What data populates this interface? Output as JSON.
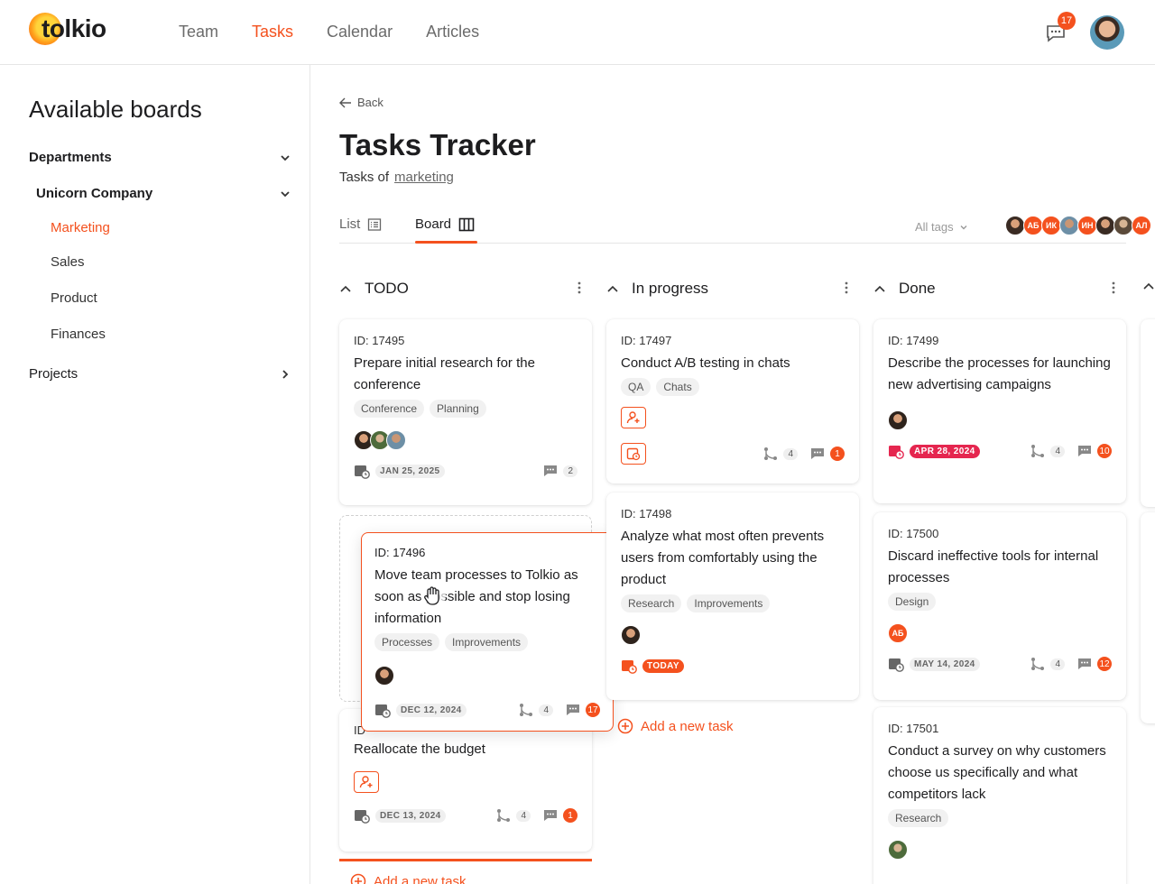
{
  "app": {
    "brand": "tolkio",
    "accent": "#f4511e"
  },
  "nav": {
    "items": [
      "Team",
      "Tasks",
      "Calendar",
      "Articles"
    ],
    "active": "Tasks"
  },
  "header": {
    "notifications_count": "17"
  },
  "sidebar": {
    "title": "Available boards",
    "departments": "Departments",
    "company": "Unicorn Company",
    "items": [
      "Marketing",
      "Sales",
      "Product",
      "Finances"
    ],
    "projects": "Projects"
  },
  "page": {
    "back": "Back",
    "title": "Tasks Tracker",
    "subtitle_prefix": "Tasks of",
    "subtitle_link": "marketing",
    "tabs": [
      "List",
      "Board"
    ],
    "tags_filter": "All tags",
    "team_initials": [
      "АБ",
      "ИК",
      "ИН",
      "АЛ"
    ]
  },
  "columns": [
    {
      "title": "TODO",
      "add_label": "Add a new task"
    },
    {
      "title": "In progress",
      "add_label": "Add a new task"
    },
    {
      "title": "Done"
    }
  ],
  "cards": {
    "c17495": {
      "id": "ID: 17495",
      "title": "Prepare initial research for the conference",
      "tags": [
        "Conference",
        "Planning"
      ],
      "date": "JAN 25, 2025",
      "comments": "2"
    },
    "c17496": {
      "id": "ID: 17496",
      "title": "Move team processes to Tolkio as soon as possible and stop losing information",
      "tags": [
        "Processes",
        "Improvements"
      ],
      "date": "DEC 12, 2024",
      "subtasks": "4",
      "comments": "17"
    },
    "c_realloc": {
      "id": "ID",
      "title": "Reallocate the budget",
      "date": "DEC 13, 2024",
      "subtasks": "4",
      "comments": "1"
    },
    "c17497": {
      "id": "ID: 17497",
      "title": "Conduct A/B testing in chats",
      "tags": [
        "QA",
        "Chats"
      ],
      "subtasks": "4",
      "comments": "1"
    },
    "c17498": {
      "id": "ID: 17498",
      "title": "Analyze what most often prevents users from comfortably using the product",
      "tags": [
        "Research",
        "Improvements"
      ],
      "date": "TODAY"
    },
    "c17499": {
      "id": "ID: 17499",
      "title": "Describe the processes for launching new advertising campaigns",
      "date": "APR 28, 2024",
      "subtasks": "4",
      "comments": "10"
    },
    "c17500": {
      "id": "ID: 17500",
      "title": "Discard ineffective tools for internal processes",
      "tags": [
        "Design"
      ],
      "assignee_initials": "АБ",
      "date": "MAY 14, 2024",
      "subtasks": "4",
      "comments": "12"
    },
    "c17501": {
      "id": "ID: 17501",
      "title": "Conduct a survey on why customers choose us specifically and what competitors lack",
      "tags": [
        "Research"
      ]
    }
  }
}
